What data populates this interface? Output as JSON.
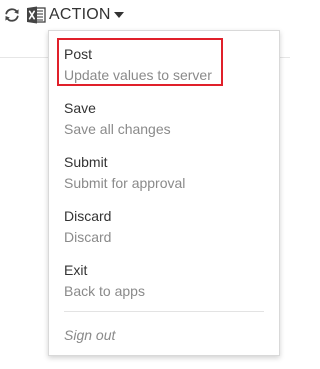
{
  "toolbar": {
    "refresh_icon": "refresh-icon",
    "excel_icon": "excel-icon",
    "action_label": "ACTION",
    "caret_icon": "caret-down-icon"
  },
  "menu": {
    "items": [
      {
        "title": "Post",
        "description": "Update values to server",
        "highlighted": true
      },
      {
        "title": "Save",
        "description": "Save all changes"
      },
      {
        "title": "Submit",
        "description": "Submit for approval"
      },
      {
        "title": "Discard",
        "description": "Discard"
      },
      {
        "title": "Exit",
        "description": "Back to apps"
      }
    ],
    "sign_out_label": "Sign out"
  },
  "colors": {
    "highlight_border": "#e0202a",
    "title_text": "#333333",
    "description_text": "#8a8a8a"
  }
}
